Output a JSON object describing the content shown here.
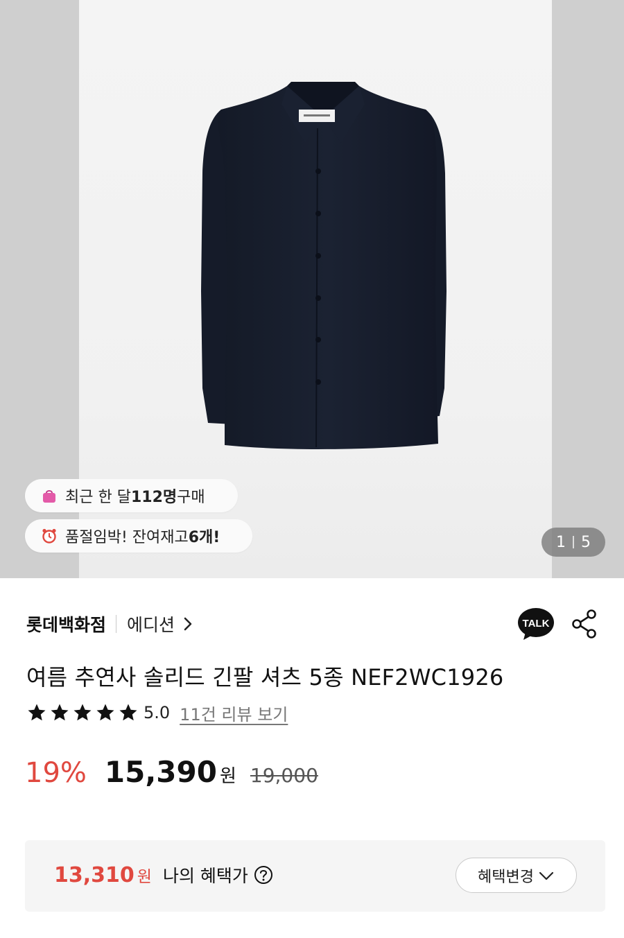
{
  "hero": {
    "badge_buyers": {
      "prefix": "최근 한 달 ",
      "count": "112명",
      "suffix": " 구매"
    },
    "badge_stock": {
      "prefix": "품절임박! 잔여재고 ",
      "count": "6개!"
    },
    "counter": {
      "current": "1",
      "total": "5"
    }
  },
  "store": {
    "name": "롯데백화점",
    "brand": "에디션"
  },
  "talk_label": "TALK",
  "product": {
    "title": "여름 추연사 솔리드 긴팔 셔츠 5종 NEF2WC1926",
    "stars": 5,
    "rating": "5.0",
    "reviews_link": "11건 리뷰 보기"
  },
  "price": {
    "discount": "19%",
    "sale": "15,390",
    "currency": "원",
    "original": "19,000"
  },
  "benefit": {
    "price": "13,310",
    "currency": "원",
    "label": "나의 혜택가",
    "change_button": "혜택변경"
  },
  "colors": {
    "accent_red": "#e0483f",
    "shirt_navy": "#161d2c"
  },
  "icons": [
    "shopping-bag-icon",
    "alarm-clock-icon",
    "chevron-right-icon",
    "talk-icon",
    "share-icon",
    "star-icon",
    "question-icon",
    "chevron-down-icon"
  ]
}
